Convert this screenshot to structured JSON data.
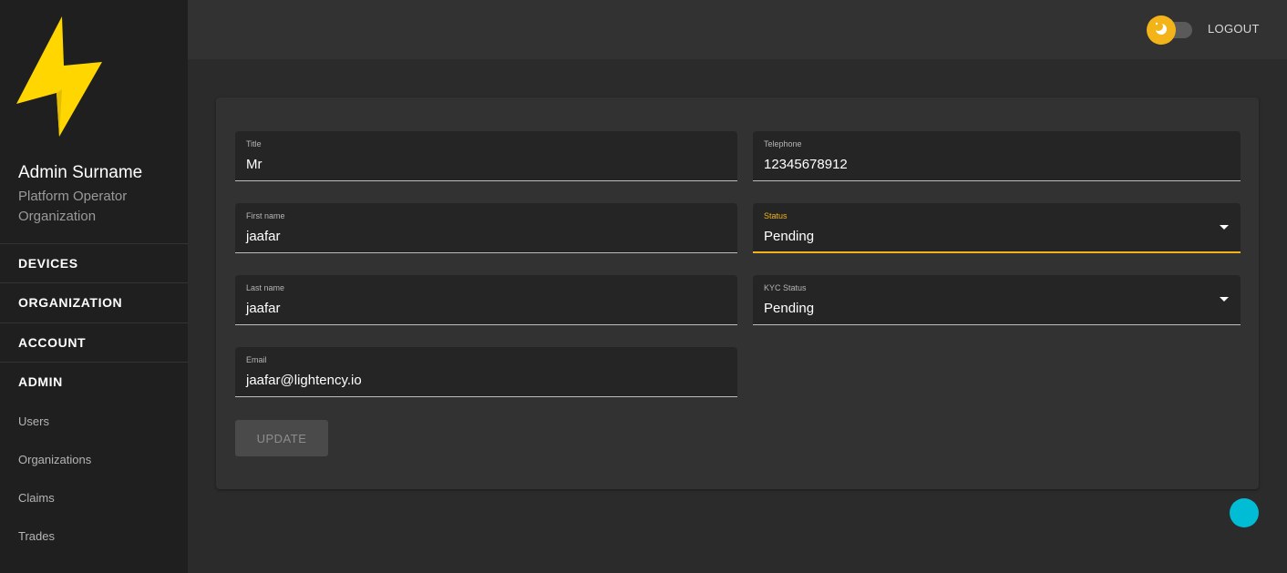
{
  "sidebar": {
    "user_name": "Admin Surname",
    "user_role": "Platform Operator Organization",
    "sections": [
      {
        "label": "DEVICES"
      },
      {
        "label": "ORGANIZATION"
      },
      {
        "label": "ACCOUNT"
      },
      {
        "label": "ADMIN"
      }
    ],
    "admin_items": [
      {
        "label": "Users"
      },
      {
        "label": "Organizations"
      },
      {
        "label": "Claims"
      },
      {
        "label": "Trades"
      }
    ]
  },
  "header": {
    "logout_label": "LOGOUT"
  },
  "form": {
    "title": {
      "label": "Title",
      "value": "Mr"
    },
    "telephone": {
      "label": "Telephone",
      "value": "12345678912"
    },
    "first_name": {
      "label": "First name",
      "value": "jaafar"
    },
    "status": {
      "label": "Status",
      "value": "Pending"
    },
    "last_name": {
      "label": "Last name",
      "value": "jaafar"
    },
    "kyc_status": {
      "label": "KYC Status",
      "value": "Pending"
    },
    "email": {
      "label": "Email",
      "value": "jaafar@lightency.io"
    },
    "update_label": "UPDATE"
  },
  "colors": {
    "accent": "#f2b418",
    "logo": "#ffd600",
    "fab": "#00bcd4"
  }
}
